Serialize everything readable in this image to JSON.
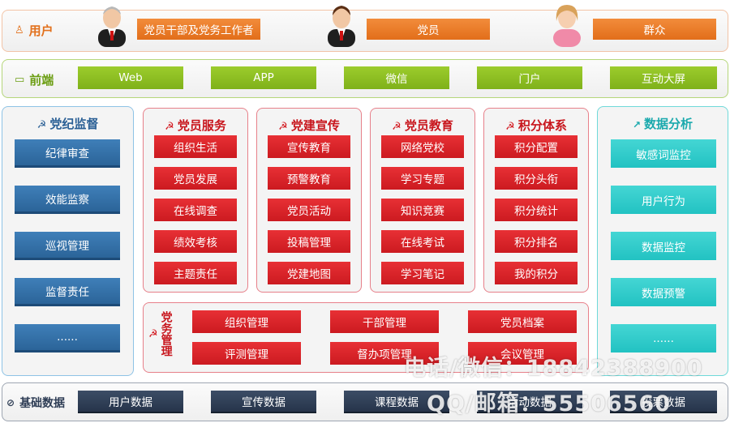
{
  "user_row": {
    "label": "用户",
    "items": [
      "党员干部及党务工作者",
      "党员",
      "群众"
    ]
  },
  "frontend_row": {
    "label": "前端",
    "items": [
      "Web",
      "APP",
      "微信",
      "门户",
      "互动大屏"
    ]
  },
  "discipline": {
    "title": "党纪监督",
    "items": [
      "纪律审查",
      "效能监察",
      "巡视管理",
      "监督责任",
      "......"
    ]
  },
  "modules": [
    {
      "title": "党员服务",
      "items": [
        "组织生活",
        "党员发展",
        "在线调查",
        "绩效考核",
        "主题责任"
      ]
    },
    {
      "title": "党建宣传",
      "items": [
        "宣传教育",
        "预警教育",
        "党员活动",
        "投稿管理",
        "党建地图"
      ]
    },
    {
      "title": "党员教育",
      "items": [
        "网络党校",
        "学习专题",
        "知识竞赛",
        "在线考试",
        "学习笔记"
      ]
    },
    {
      "title": "积分体系",
      "items": [
        "积分配置",
        "积分头衔",
        "积分统计",
        "积分排名",
        "我的积分"
      ]
    }
  ],
  "party_affairs": {
    "title": "党务管理",
    "items": [
      "组织管理",
      "干部管理",
      "党员档案",
      "评测管理",
      "督办项管理",
      "会议管理"
    ]
  },
  "analysis": {
    "title": "数据分析",
    "items": [
      "敏感词监控",
      "用户行为",
      "数据监控",
      "数据预警",
      "......"
    ]
  },
  "base_row": {
    "label": "基础数据",
    "items": [
      "用户数据",
      "宣传数据",
      "课程数据",
      "活动数据",
      "投票数据"
    ]
  },
  "watermark": {
    "line1": "电话/微信：18842388900",
    "line2": "QQ/邮箱：55506560"
  },
  "colors": {
    "orange": "#e87a2a",
    "green": "#8cbf22",
    "blue": "#2f6ea8",
    "red": "#d8232a",
    "teal": "#2ccccc",
    "navy": "#2e3d55"
  }
}
